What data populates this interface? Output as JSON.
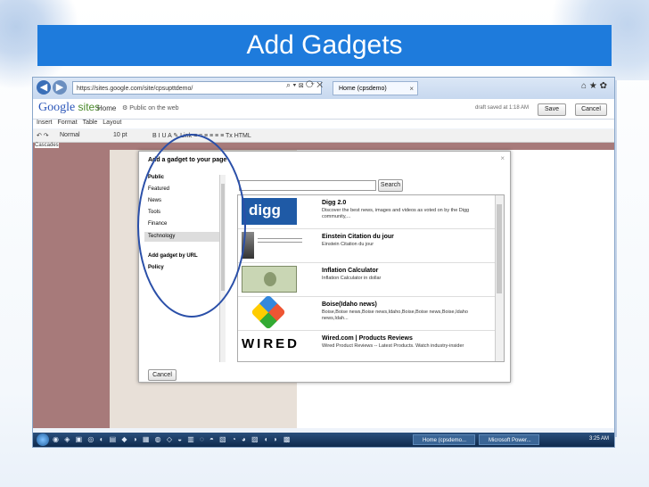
{
  "slide": {
    "title": "Add Gadgets"
  },
  "browser": {
    "url": "https://sites.google.com/site/cpsupttdemo/",
    "tab_label": "Home (cpsdemo)",
    "tab_close": "×",
    "nav_icons": "⌕ ▾ ⊠ ⟳ ✕",
    "right_icons": "⌂ ★ ✿"
  },
  "sites_header": {
    "logo_google": "Google",
    "logo_sites": " sites",
    "home": "Home",
    "public": "⚙ Public on the web",
    "draft": "draft saved at 1:18 AM",
    "save": "Save",
    "cancel": "Cancel"
  },
  "menu": {
    "insert": "Insert",
    "format": "Format",
    "table": "Table",
    "layout": "Layout"
  },
  "format_bar": {
    "style": "Normal",
    "size": "10 pt",
    "tools": "B  I  U  A  ✎  Link  ≡  ≡  ≡  ≡  ≡  ≡  Tx  HTML"
  },
  "edit_label": "Cascades",
  "dialog": {
    "title": "Add a gadget to your page",
    "close": "×",
    "categories": [
      {
        "label": "Public",
        "bold": true
      },
      {
        "label": "Featured",
        "bold": false
      },
      {
        "label": "News",
        "bold": false
      },
      {
        "label": "Tools",
        "bold": false
      },
      {
        "label": "Finance",
        "bold": false
      },
      {
        "label": "Technology",
        "bold": false,
        "selected": true
      }
    ],
    "by_url": "Add gadget by URL",
    "policy": "Policy",
    "search_button": "Search",
    "results": [
      {
        "title": "Digg 2.0",
        "desc": "Discover the best news, images and videos as voted on by the Digg community,...",
        "thumb": "digg-logo"
      },
      {
        "title": "Einstein Citation du jour",
        "desc": "Einstein Citation du jour",
        "thumb": "einstein-photo"
      },
      {
        "title": "Inflation Calculator",
        "desc": "Inflation Calculator in dollar",
        "thumb": "dollar-bill"
      },
      {
        "title": "Boise(Idaho news)",
        "desc": "Boise,Boise news,Boise news,Idaho,Boise,Boise news,Boise,Idaho news,Idah...",
        "thumb": "boise-logo"
      },
      {
        "title": "Wired.com | Products Reviews",
        "desc": "Wired Product Reviews -- Latest Products. Watch industry-insider",
        "thumb": "wired-logo"
      }
    ],
    "cancel": "Cancel",
    "digg_text": "digg",
    "wired_text": "WIRED"
  },
  "taskbar": {
    "task1": "Home (cpsdemo...",
    "task2": "Microsoft Power...",
    "clock": "3:25 AM",
    "quick_icons": "◉ ◈ ▣ ◎ ◐ ▤ ◆ ◑ ▦ ◍ ◇ ◒ ▥ ◌ ◓ ▧ ◔ ◕ ▨ ◖ ◗ ▩"
  },
  "colors": {
    "title_bar": "#1e7bdc",
    "annotation": "#2a4fa8"
  }
}
